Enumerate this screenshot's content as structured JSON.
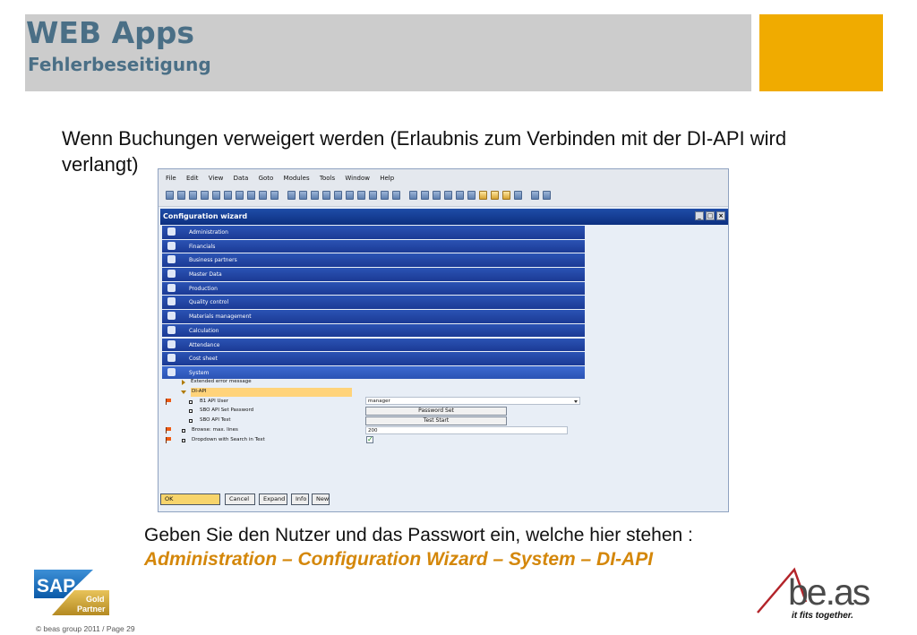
{
  "header": {
    "title": "WEB Apps",
    "subtitle": "Fehlerbeseitigung",
    "accent_color": "#f0ab00",
    "bar_color": "#cccccc"
  },
  "intro_text": "Wenn Buchungen verweigert werden (Erlaubnis zum Verbinden mit der DI-API  wird verlangt)",
  "app": {
    "menu": [
      "File",
      "Edit",
      "View",
      "Data",
      "Goto",
      "Modules",
      "Tools",
      "Window",
      "Help"
    ],
    "window_title": "Configuration wizard",
    "window_buttons": [
      "_",
      "□",
      "×"
    ],
    "modules": [
      {
        "label": "Administration",
        "icon": "administration-icon"
      },
      {
        "label": "Financials",
        "icon": "financials-icon"
      },
      {
        "label": "Business partners",
        "icon": "business-partners-icon"
      },
      {
        "label": "Master Data",
        "icon": "master-data-icon"
      },
      {
        "label": "Production",
        "icon": "production-icon"
      },
      {
        "label": "Quality control",
        "icon": "quality-control-icon"
      },
      {
        "label": "Materials management",
        "icon": "materials-management-icon"
      },
      {
        "label": "Calculation",
        "icon": "calculation-icon"
      },
      {
        "label": "Attendance",
        "icon": "attendance-icon"
      },
      {
        "label": "Cost sheet",
        "icon": "cost-sheet-icon"
      },
      {
        "label": "System",
        "icon": "system-icon"
      }
    ],
    "tree": {
      "extended_error": "Extended error message",
      "di_api": "DI-API",
      "b1_api_user": "B1 API User",
      "sbo_password": "SBO API Set Password",
      "sbo_test": "SBO API Test",
      "browse_max": "Browse: max. lines",
      "dropdown_search": "Dropdown with Search in Text"
    },
    "fields": {
      "user_value": "manager",
      "password_button": "Password Set",
      "test_button": "Test Start",
      "max_lines_value": "200",
      "dropdown_checked": "✓"
    },
    "buttons": {
      "ok": "OK",
      "cancel": "Cancel",
      "expand": "Expand",
      "info": "Info",
      "new": "New"
    }
  },
  "instruction": {
    "line1": "Geben Sie den Nutzer und das Passwort ein, welche hier stehen :",
    "line2": "Administration – Configuration Wizard – System – DI-API"
  },
  "footer": {
    "copyright": "© beas group 2011 / Page 29",
    "sap_logo_text": "SAP",
    "sap_gold": "Gold",
    "sap_partner": "Partner",
    "beas_logo": "be.as",
    "beas_slogan": "it fits together."
  }
}
